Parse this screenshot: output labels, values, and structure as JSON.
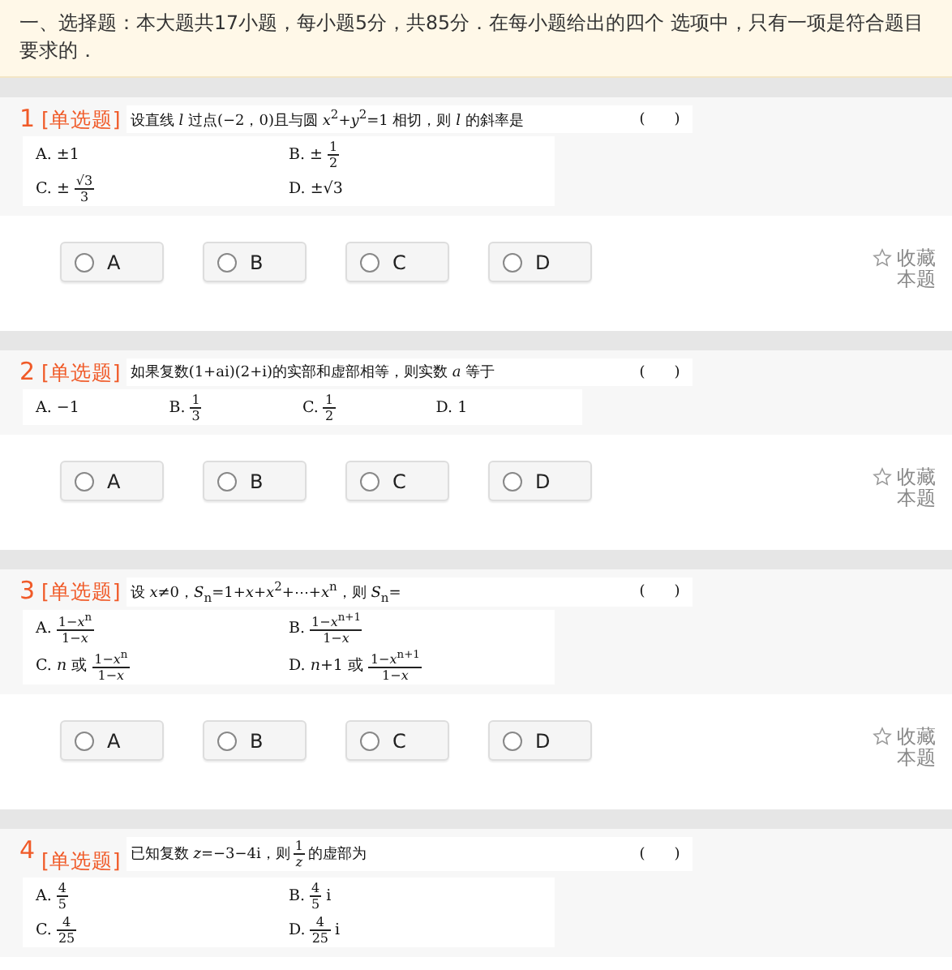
{
  "section_header": "一、选择题：本大题共17小题，每小题5分，共85分．在每小题给出的四个 选项中，只有一项是符合题目要求的．",
  "questions": [
    {
      "number": "1",
      "type_tag": "[单选题]",
      "stem": [
        {
          "kind": "text",
          "text": "设直线 *l* 过点(−2，0)且与圆 *x*$^{2}$+*y*$^{2}$=1 相切，则 *l* 的斜率是"
        }
      ],
      "blank": "(　　)",
      "kind": "standard",
      "options": [
        {
          "label": "A.",
          "parts": [
            {
              "kind": "text",
              "text": "±1"
            }
          ]
        },
        {
          "label": "B.",
          "parts": [
            {
              "kind": "text",
              "text": "±"
            },
            {
              "kind": "frac",
              "num": "1",
              "den": "2"
            }
          ]
        },
        {
          "label": "C.",
          "parts": [
            {
              "kind": "text",
              "text": "±"
            },
            {
              "kind": "frac",
              "num": "√3",
              "den": "3"
            }
          ]
        },
        {
          "label": "D.",
          "parts": [
            {
              "kind": "text",
              "text": "±√3"
            }
          ]
        }
      ],
      "answers": [
        {
          "label": "A",
          "selected": false
        },
        {
          "label": "B",
          "selected": false
        },
        {
          "label": "C",
          "selected": false
        },
        {
          "label": "D",
          "selected": false
        }
      ],
      "favorite": "收藏本题"
    },
    {
      "number": "2",
      "type_tag": "[单选题]",
      "stem": [
        {
          "kind": "text",
          "text": "如果复数(1+ai)(2+i)的实部和虚部相等，则实数 *a* 等于"
        }
      ],
      "blank": "(　　)",
      "kind": "compact",
      "options": [
        {
          "label": "A.",
          "parts": [
            {
              "kind": "text",
              "text": "−1"
            }
          ]
        },
        {
          "label": "B.",
          "parts": [
            {
              "kind": "frac",
              "num": "1",
              "den": "3"
            }
          ]
        },
        {
          "label": "C.",
          "parts": [
            {
              "kind": "frac",
              "num": "1",
              "den": "2"
            }
          ]
        },
        {
          "label": "D.",
          "parts": [
            {
              "kind": "text",
              "text": "1"
            }
          ]
        }
      ],
      "answers": [
        {
          "label": "A",
          "selected": false
        },
        {
          "label": "B",
          "selected": false
        },
        {
          "label": "C",
          "selected": false
        },
        {
          "label": "D",
          "selected": false
        }
      ],
      "favorite": "收藏本题"
    },
    {
      "number": "3",
      "type_tag": "[单选题]",
      "stem": [
        {
          "kind": "text",
          "text": "设 *x*≠0，*S*$_{n}$=1+*x*+*x*$^{2}$+⋯+*x*$^{n}$，则 *S*$_{n}$="
        }
      ],
      "blank": "(　　)",
      "kind": "standard",
      "options": [
        {
          "label": "A.",
          "parts": [
            {
              "kind": "frac",
              "num": "1−*x*$^{n}$",
              "den": "1−*x*"
            }
          ]
        },
        {
          "label": "B.",
          "parts": [
            {
              "kind": "frac",
              "num": "1−*x*$^{n+1}$",
              "den": "1−*x*"
            }
          ]
        },
        {
          "label": "C.",
          "parts": [
            {
              "kind": "text",
              "text": "*n* 或"
            },
            {
              "kind": "frac",
              "num": "1−*x*$^{n}$",
              "den": "1−*x*"
            }
          ]
        },
        {
          "label": "D.",
          "parts": [
            {
              "kind": "text",
              "text": "*n*+1 或"
            },
            {
              "kind": "frac",
              "num": "1−*x*$^{n+1}$",
              "den": "1−*x*"
            }
          ]
        }
      ],
      "answers": [
        {
          "label": "A",
          "selected": false
        },
        {
          "label": "B",
          "selected": false
        },
        {
          "label": "C",
          "selected": false
        },
        {
          "label": "D",
          "selected": false
        }
      ],
      "favorite": "收藏本题"
    },
    {
      "number": "4",
      "type_tag": "[单选题]",
      "stem": [
        {
          "kind": "text",
          "text": "已知复数 *z*=−3−4i，则"
        },
        {
          "kind": "frac",
          "num": "1",
          "den": "*z*"
        },
        {
          "kind": "text",
          "text": "的虚部为"
        }
      ],
      "blank": "(　　)",
      "kind": "standard",
      "options": [
        {
          "label": "A.",
          "parts": [
            {
              "kind": "frac",
              "num": "4",
              "den": "5"
            }
          ]
        },
        {
          "label": "B.",
          "parts": [
            {
              "kind": "frac",
              "num": "4",
              "den": "5"
            },
            {
              "kind": "text",
              "text": "i"
            }
          ]
        },
        {
          "label": "C.",
          "parts": [
            {
              "kind": "frac",
              "num": "4",
              "den": "25"
            }
          ]
        },
        {
          "label": "D.",
          "parts": [
            {
              "kind": "frac",
              "num": "4",
              "den": "25"
            },
            {
              "kind": "text",
              "text": "i"
            }
          ]
        }
      ]
    }
  ]
}
